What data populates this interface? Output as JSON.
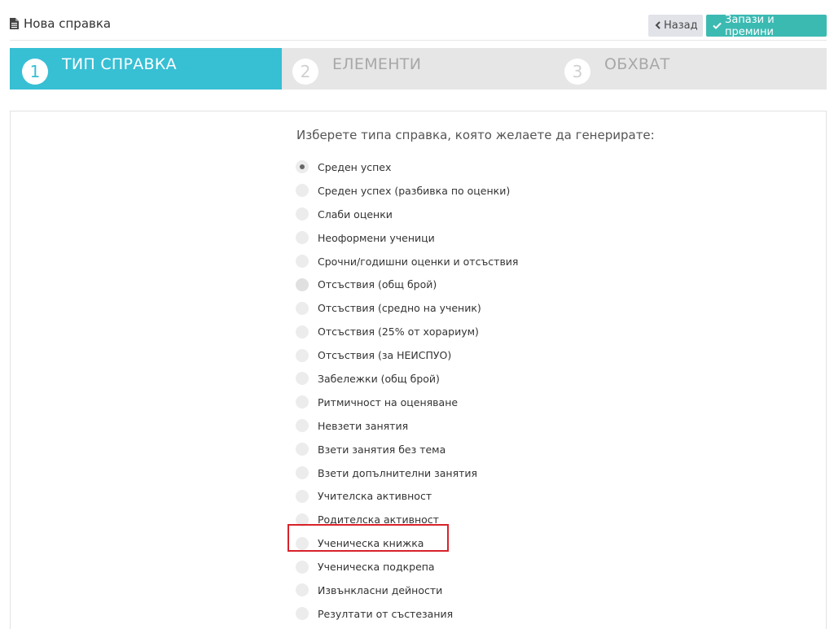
{
  "header": {
    "title": "Нова справка",
    "back_label": "Назад",
    "save_label": "Запази и премини"
  },
  "steps": [
    {
      "number": "1",
      "label": "ТИП СПРАВКА",
      "active": true
    },
    {
      "number": "2",
      "label": "ЕЛЕМЕНТИ",
      "active": false
    },
    {
      "number": "3",
      "label": "ОБХВАТ",
      "active": false
    }
  ],
  "form": {
    "question": "Изберете типа справка, която желаете да генерирате:",
    "selected_index": 0,
    "options": [
      "Среден успех",
      "Среден успех (разбивка по оценки)",
      "Слаби оценки",
      "Неоформени ученици",
      "Срочни/годишни оценки и отсъствия",
      "Отсъствия (общ брой)",
      "Отсъствия (средно на ученик)",
      "Отсъствия (25% от хорариум)",
      "Отсъствия (за НЕИСПУО)",
      "Забележки (общ брой)",
      "Ритмичност на оценяване",
      "Невзети занятия",
      "Взети занятия без тема",
      "Взети допълнителни занятия",
      "Учителска активност",
      "Родителска активност",
      "Ученическа книжка",
      "Ученическа подкрепа",
      "Извънкласни дейности",
      "Резултати от състезания"
    ]
  },
  "colors": {
    "accent": "#37bfd4",
    "save_button": "#3bbab2",
    "highlight": "#d9222a"
  }
}
